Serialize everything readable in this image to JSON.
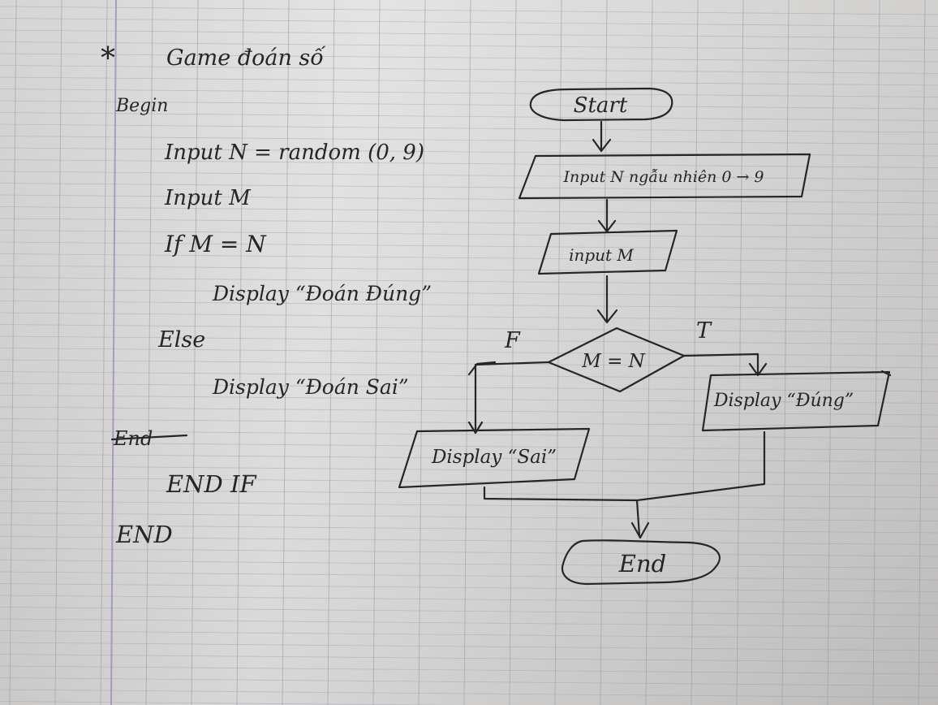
{
  "pseudocode": {
    "title": "Game đoán số",
    "begin": "Begin",
    "line_input_n": "Input N = random (0, 9)",
    "line_input_m": "Input M",
    "line_if": "If  M = N",
    "line_display_correct": "Display “Đoán Đúng”",
    "line_else": "Else",
    "line_display_wrong": "Display “Đoán Sai”",
    "struck_word": "End",
    "line_end_if": "END IF",
    "line_end": "END"
  },
  "flowchart": {
    "start": "Start",
    "input_n": "Input N ngẫu nhiên 0 → 9",
    "input_m": "input M",
    "decision": "M = N",
    "false_label": "F",
    "true_label": "T",
    "display_false": "Display “Sai”",
    "display_true": "Display “Đúng”",
    "end": "End"
  },
  "colors": {
    "ink": "#262629",
    "paper": "#d3d2d0",
    "grid_line": "#8f97b0",
    "margin_line": "#9a8fb6"
  }
}
